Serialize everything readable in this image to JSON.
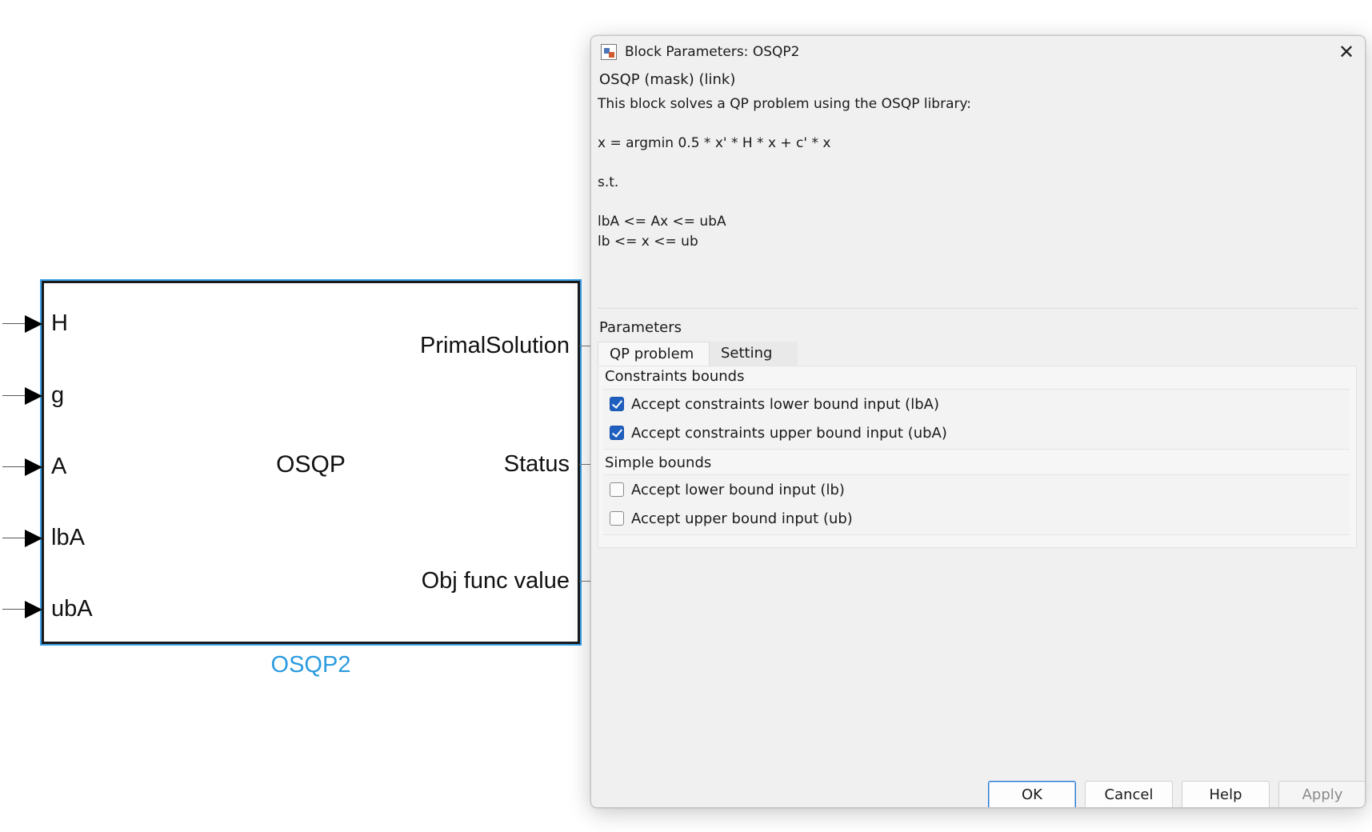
{
  "block": {
    "center_label": "OSQP",
    "name": "OSQP2",
    "inputs": [
      "H",
      "g",
      "A",
      "lbA",
      "ubA"
    ],
    "outputs": [
      "PrimalSolution",
      "Status",
      "Obj func value"
    ]
  },
  "dialog": {
    "title": "Block Parameters: OSQP2",
    "close_glyph": "✕",
    "mask_title": "OSQP (mask) (link)",
    "description_lines": [
      "This block solves a QP problem using the OSQP library:",
      "",
      "x = argmin 0.5 * x' * H * x + c' * x",
      "",
      "s.t.",
      "",
      "lbA <= Ax <= ubA",
      "lb <= x <= ub"
    ],
    "parameters_label": "Parameters",
    "tabs": [
      {
        "label": "QP problem",
        "active": true
      },
      {
        "label": "Setting",
        "active": false
      }
    ],
    "groups": [
      {
        "title": "Constraints bounds",
        "options": [
          {
            "label": "Accept constraints lower bound input (lbA)",
            "checked": true
          },
          {
            "label": "Accept constraints upper bound input (ubA)",
            "checked": true
          }
        ]
      },
      {
        "title": "Simple bounds",
        "options": [
          {
            "label": "Accept lower bound input (lb)",
            "checked": false
          },
          {
            "label": "Accept upper bound input (ub)",
            "checked": false
          }
        ]
      }
    ],
    "buttons": {
      "ok": "OK",
      "cancel": "Cancel",
      "help": "Help",
      "apply": "Apply"
    }
  },
  "colors": {
    "block_highlight": "#3aa0e8",
    "block_name": "#2b9be0",
    "checkbox_checked": "#1f5fbf",
    "dialog_background": "#f0f0f0"
  }
}
